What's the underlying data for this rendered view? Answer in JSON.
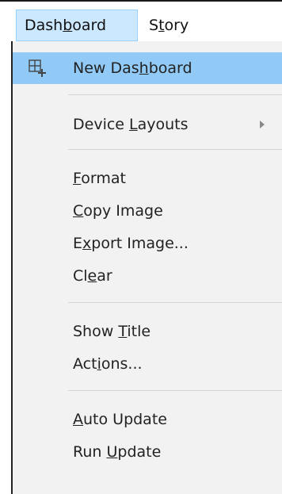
{
  "menubar": {
    "items": [
      {
        "text": "Dashboard",
        "underline_index": 4
      },
      {
        "text": "Story",
        "underline_index": 1
      }
    ]
  },
  "menu": {
    "items": [
      {
        "text": "New Dashboard",
        "underline_index": 7,
        "icon": "new-dashboard-icon",
        "highlight": true
      },
      {
        "text": "Device Layouts",
        "underline_index": 7,
        "submenu": true
      },
      {
        "text": "Format",
        "underline_index": 0
      },
      {
        "text": "Copy Image",
        "underline_index": 0
      },
      {
        "text": "Export Image...",
        "underline_index": 1
      },
      {
        "text": "Clear",
        "underline_index": 2
      },
      {
        "text": "Show Title",
        "underline_index": 5
      },
      {
        "text": "Actions...",
        "underline_index": 3
      },
      {
        "text": "Auto Update",
        "underline_index": 0
      },
      {
        "text": "Run Update",
        "underline_index": 4
      }
    ]
  },
  "colors": {
    "highlight": "#91c9f7",
    "menubar_open": "#cce8ff",
    "menu_background": "#f2f2f2",
    "separator": "#d6d6d6"
  }
}
